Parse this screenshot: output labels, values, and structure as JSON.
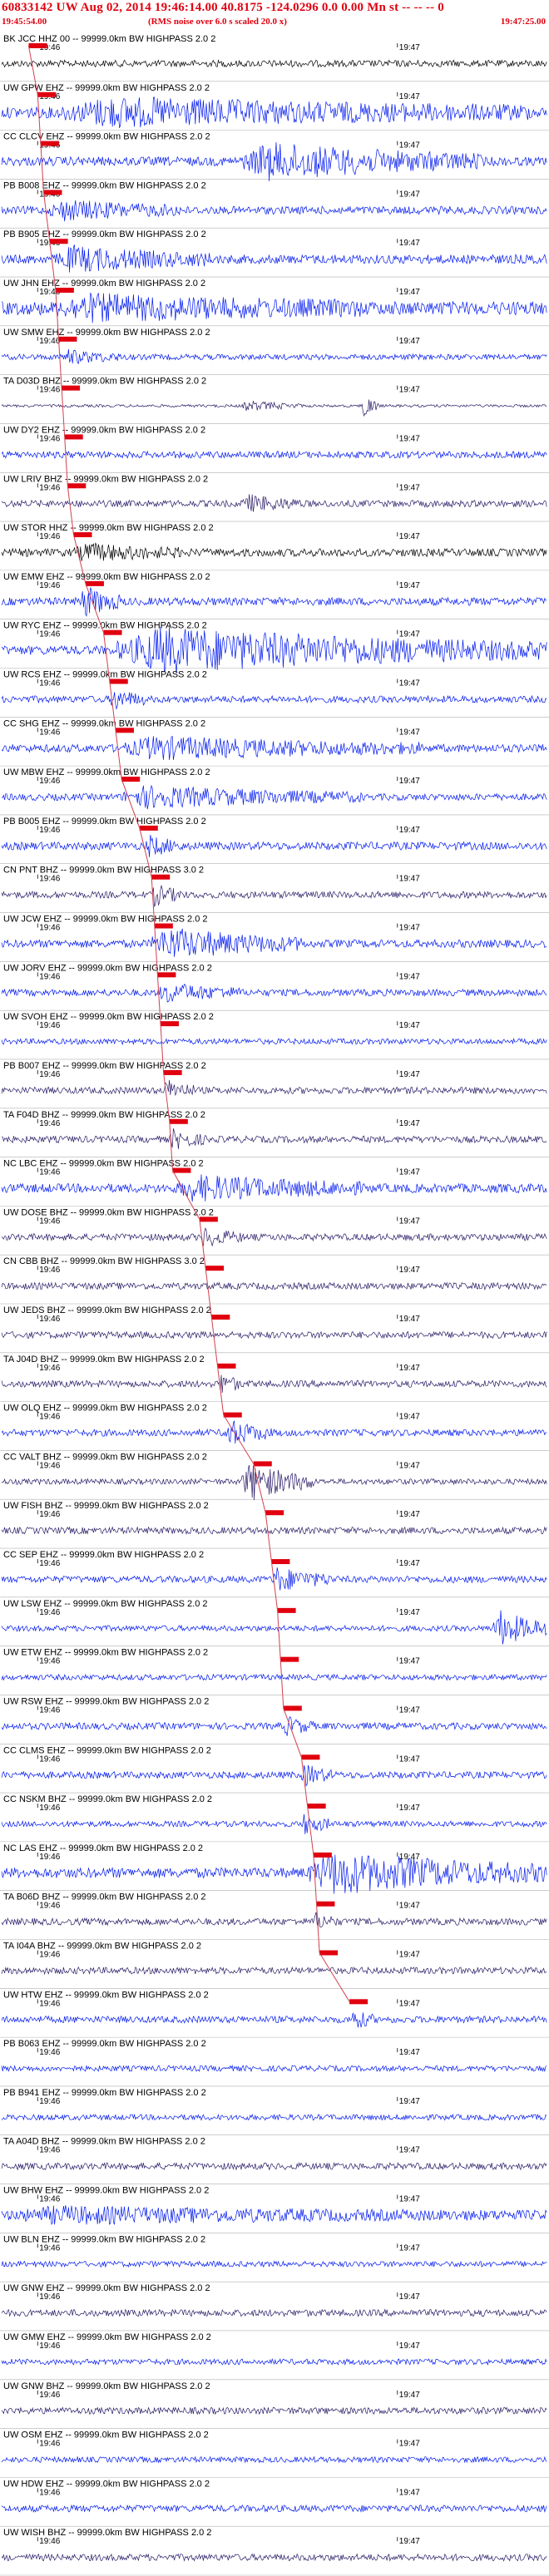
{
  "header": {
    "title": "60833142 UW Aug 02, 2014 19:46:14.00   40.8175 -124.0296  0.0 0.00 Mn st -- -- -- 0",
    "start_time": "19:45:54.00",
    "note": "(RMS noise over 6.0 s scaled 20.0 x)",
    "end_time": "19:47:25.00"
  },
  "colors": {
    "header_text": "#e0000f",
    "pick_box": "#e0000f",
    "pick_line": "#d04050",
    "trace_palette": [
      "#0018f0",
      "#2a1a66",
      "#000000"
    ]
  },
  "chart_data": {
    "type": "line",
    "title": "60833142 UW Aug 02, 2014 19:46:14.00   40.8175 -124.0296  0.0 0.00 Mn st -- -- -- 0",
    "x_range_time": [
      "19:45:54.00",
      "19:47:25.00"
    ],
    "x_tick_labels": [
      "19:46",
      "19:47"
    ],
    "tick_times_s": [
      6,
      66
    ],
    "pick_line": true,
    "traces": [
      {
        "label": "BK JCC HHZ 00 -- 99999.0km BW HIGHPASS 2.0 2",
        "pick_s": 4.5,
        "color": 2,
        "amp": 0.3,
        "bursts": []
      },
      {
        "label": "UW GPW EHZ -- 99999.0km BW HIGHPASS 2.0 2",
        "pick_s": 6,
        "color": 0,
        "amp": 0.5,
        "bursts": [
          [
            10,
            88,
            1.0
          ]
        ]
      },
      {
        "label": "CC CLCV EHZ -- 99999.0km BW HIGHPASS 2.0 2",
        "pick_s": 6.5,
        "color": 0,
        "amp": 0.4,
        "bursts": [
          [
            40,
            80,
            1.4
          ]
        ]
      },
      {
        "label": "PB B008 EHZ -- 99999.0km BW HIGHPASS 2.0 2",
        "pick_s": 7,
        "color": 0,
        "amp": 0.35,
        "bursts": [
          [
            8,
            30,
            0.7
          ]
        ]
      },
      {
        "label": "PB B905 EHZ -- 99999.0km BW HIGHPASS 2.0 2",
        "pick_s": 8,
        "color": 0,
        "amp": 0.4,
        "bursts": [
          [
            9,
            35,
            0.9
          ]
        ]
      },
      {
        "label": "UW JHN EHZ -- 99999.0km BW HIGHPASS 2.0 2",
        "pick_s": 9,
        "color": 0,
        "amp": 0.6,
        "bursts": [
          [
            9,
            60,
            0.8
          ]
        ]
      },
      {
        "label": "UW SMW EHZ -- 99999.0km BW HIGHPASS 2.0 2",
        "pick_s": 9.5,
        "color": 0,
        "amp": 0.25,
        "bursts": [
          [
            10,
            20,
            0.5
          ]
        ]
      },
      {
        "label": "TA D03D BHZ -- 99999.0km BW HIGHPASS 2.0 2",
        "pick_s": 10,
        "color": 1,
        "amp": 0.12,
        "bursts": [
          [
            40,
            50,
            0.4
          ],
          [
            60,
            63,
            1.1
          ]
        ]
      },
      {
        "label": "UW DY2 EHZ -- 99999.0km BW HIGHPASS 2.0 2",
        "pick_s": 10.5,
        "color": 0,
        "amp": 0.3,
        "bursts": []
      },
      {
        "label": "UW LRIV BHZ -- 99999.0km BW HIGHPASS 2.0 2",
        "pick_s": 11,
        "color": 1,
        "amp": 0.3,
        "bursts": [
          [
            40,
            50,
            0.6
          ]
        ]
      },
      {
        "label": "UW STOR HHZ -- 99999.0km BW HIGHPASS 2.0 2",
        "pick_s": 12,
        "color": 2,
        "amp": 0.35,
        "bursts": [
          [
            12,
            30,
            0.6
          ]
        ]
      },
      {
        "label": "UW EMW EHZ -- 99999.0km BW HIGHPASS 2.0 2",
        "pick_s": 14,
        "color": 0,
        "amp": 0.35,
        "bursts": [
          [
            13,
            20,
            1.2
          ]
        ]
      },
      {
        "label": "UW RYC EHZ -- 99999.0km BW HIGHPASS 2.0 2",
        "pick_s": 17,
        "color": 0,
        "amp": 0.4,
        "bursts": [
          [
            19,
            91,
            1.8
          ]
        ]
      },
      {
        "label": "UW RCS EHZ -- 99999.0km BW HIGHPASS 2.0 2",
        "pick_s": 18,
        "color": 0,
        "amp": 0.3,
        "bursts": [
          [
            18,
            24,
            0.8
          ]
        ]
      },
      {
        "label": "CC SHG EHZ -- 99999.0km BW HIGHPASS 2.0 2",
        "pick_s": 19,
        "color": 0,
        "amp": 0.35,
        "bursts": [
          [
            20,
            70,
            0.8
          ]
        ]
      },
      {
        "label": "UW MBW EHZ -- 99999.0km BW HIGHPASS 2.0 2",
        "pick_s": 20,
        "color": 0,
        "amp": 0.3,
        "bursts": [
          [
            20,
            60,
            0.8
          ]
        ]
      },
      {
        "label": "PB B005 EHZ -- 99999.0km BW HIGHPASS 2.0 2",
        "pick_s": 23,
        "color": 0,
        "amp": 0.35,
        "bursts": [
          [
            24,
            30,
            0.7
          ]
        ]
      },
      {
        "label": "CN PNT BHZ -- 99999.0km BW HIGHPASS 3.0 2",
        "pick_s": 25,
        "color": 1,
        "amp": 0.3,
        "bursts": [
          [
            25,
            30,
            0.8
          ]
        ]
      },
      {
        "label": "UW JCW EHZ -- 99999.0km BW HIGHPASS 2.0 2",
        "pick_s": 25.5,
        "color": 0,
        "amp": 0.35,
        "bursts": [
          [
            25,
            50,
            1.2
          ]
        ]
      },
      {
        "label": "UW JORV EHZ -- 99999.0km BW HIGHPASS 2.0 2",
        "pick_s": 26,
        "color": 0,
        "amp": 0.3,
        "bursts": [
          [
            26,
            40,
            0.7
          ]
        ]
      },
      {
        "label": "UW SVOH EHZ -- 99999.0km BW HIGHPASS 2.0 2",
        "pick_s": 26.5,
        "color": 0,
        "amp": 0.25,
        "bursts": []
      },
      {
        "label": "PB B007 EHZ -- 99999.0km BW HIGHPASS 2.0 2",
        "pick_s": 27,
        "color": 1,
        "amp": 0.3,
        "bursts": [
          [
            27,
            32,
            0.8
          ]
        ]
      },
      {
        "label": "TA F04D BHZ -- 99999.0km BW HIGHPASS 2.0 2",
        "pick_s": 28,
        "color": 1,
        "amp": 0.3,
        "bursts": [
          [
            28,
            34,
            0.7
          ]
        ]
      },
      {
        "label": "NC LBC EHZ -- 99999.0km BW HIGHPASS 2.0 2",
        "pick_s": 28.5,
        "color": 0,
        "amp": 0.4,
        "bursts": [
          [
            29,
            60,
            0.9
          ]
        ]
      },
      {
        "label": "UW DOSE BHZ -- 99999.0km BW HIGHPASS 2.0 2",
        "pick_s": 33,
        "color": 1,
        "amp": 0.3,
        "bursts": [
          [
            33,
            40,
            0.7
          ]
        ]
      },
      {
        "label": "CN CBB BHZ -- 99999.0km BW HIGHPASS 3.0 2",
        "pick_s": 34,
        "color": 1,
        "amp": 0.3,
        "bursts": []
      },
      {
        "label": "UW JEDS BHZ -- 99999.0km BW HIGHPASS 2.0 2",
        "pick_s": 35,
        "color": 1,
        "amp": 0.3,
        "bursts": []
      },
      {
        "label": "TA J04D BHZ -- 99999.0km BW HIGHPASS 2.0 2",
        "pick_s": 36,
        "color": 1,
        "amp": 0.3,
        "bursts": [
          [
            36,
            40,
            0.8
          ]
        ]
      },
      {
        "label": "UW OLQ EHZ -- 99999.0km BW HIGHPASS 2.0 2",
        "pick_s": 37,
        "color": 0,
        "amp": 0.3,
        "bursts": [
          [
            37,
            45,
            1.0
          ]
        ]
      },
      {
        "label": "CC VALT BHZ -- 99999.0km BW HIGHPASS 2.0 2",
        "pick_s": 42,
        "color": 1,
        "amp": 0.25,
        "bursts": [
          [
            40,
            52,
            1.6
          ]
        ]
      },
      {
        "label": "UW FISH BHZ -- 99999.0km BW HIGHPASS 2.0 2",
        "pick_s": 44,
        "color": 1,
        "amp": 0.3,
        "bursts": []
      },
      {
        "label": "CC SEP EHZ -- 99999.0km BW HIGHPASS 2.0 2",
        "pick_s": 45,
        "color": 0,
        "amp": 0.3,
        "bursts": [
          [
            45,
            55,
            0.9
          ]
        ]
      },
      {
        "label": "UW LSW EHZ -- 99999.0km BW HIGHPASS 2.0 2",
        "pick_s": 46,
        "color": 0,
        "amp": 0.25,
        "bursts": [
          [
            82,
            91,
            1.5
          ]
        ]
      },
      {
        "label": "UW ETW EHZ -- 99999.0km BW HIGHPASS 2.0 2",
        "pick_s": 46.5,
        "color": 0,
        "amp": 0.25,
        "bursts": []
      },
      {
        "label": "UW RSW EHZ -- 99999.0km BW HIGHPASS 2.0 2",
        "pick_s": 47,
        "color": 0,
        "amp": 0.3,
        "bursts": [
          [
            47,
            52,
            0.7
          ]
        ]
      },
      {
        "label": "CC CLMS EHZ -- 99999.0km BW HIGHPASS 2.0 2",
        "pick_s": 50,
        "color": 0,
        "amp": 0.3,
        "bursts": [
          [
            50,
            55,
            0.8
          ]
        ]
      },
      {
        "label": "CC NSKM BHZ -- 99999.0km BW HIGHPASS 2.0 2",
        "pick_s": 51,
        "color": 0,
        "amp": 0.25,
        "bursts": [
          [
            50,
            55,
            0.8
          ]
        ]
      },
      {
        "label": "NC LAS EHZ -- 99999.0km BW HIGHPASS 2.0 2",
        "pick_s": 52,
        "color": 0,
        "amp": 0.45,
        "bursts": [
          [
            51,
            91,
            1.6
          ]
        ]
      },
      {
        "label": "TA B06D BHZ -- 99999.0km BW HIGHPASS 2.0 2",
        "pick_s": 52.5,
        "color": 1,
        "amp": 0.3,
        "bursts": [
          [
            52,
            56,
            0.6
          ]
        ]
      },
      {
        "label": "TA I04A BHZ -- 99999.0km BW HIGHPASS 2.0 2",
        "pick_s": 53,
        "color": 1,
        "amp": 0.3,
        "bursts": []
      },
      {
        "label": "UW HTW EHZ -- 99999.0km BW HIGHPASS 2.0 2",
        "pick_s": 58,
        "color": 0,
        "amp": 0.3,
        "bursts": [
          [
            58,
            62,
            0.8
          ]
        ]
      },
      {
        "label": "PB B063 EHZ -- 99999.0km BW HIGHPASS 2.0 2",
        "pick_s": null,
        "color": 0,
        "amp": 0.25,
        "bursts": []
      },
      {
        "label": "PB B941 EHZ -- 99999.0km BW HIGHPASS 2.0 2",
        "pick_s": null,
        "color": 0,
        "amp": 0.25,
        "bursts": []
      },
      {
        "label": "TA A04D BHZ -- 99999.0km BW HIGHPASS 2.0 2",
        "pick_s": null,
        "color": 1,
        "amp": 0.3,
        "bursts": []
      },
      {
        "label": "UW BHW EHZ -- 99999.0km BW HIGHPASS 2.0 2",
        "pick_s": null,
        "color": 0,
        "amp": 0.3,
        "bursts": [
          [
            0,
            91,
            0.6
          ]
        ]
      },
      {
        "label": "UW BLN EHZ -- 99999.0km BW HIGHPASS 2.0 2",
        "pick_s": null,
        "color": 0,
        "amp": 0.25,
        "bursts": []
      },
      {
        "label": "UW GNW EHZ -- 99999.0km BW HIGHPASS 2.0 2",
        "pick_s": null,
        "color": 1,
        "amp": 0.3,
        "bursts": []
      },
      {
        "label": "UW GMW EHZ -- 99999.0km BW HIGHPASS 2.0 2",
        "pick_s": null,
        "color": 0,
        "amp": 0.25,
        "bursts": []
      },
      {
        "label": "UW GNW BHZ -- 99999.0km BW HIGHPASS 2.0 2",
        "pick_s": null,
        "color": 1,
        "amp": 0.3,
        "bursts": []
      },
      {
        "label": "UW OSM EHZ -- 99999.0km BW HIGHPASS 2.0 2",
        "pick_s": null,
        "color": 0,
        "amp": 0.25,
        "bursts": []
      },
      {
        "label": "UW HDW EHZ -- 99999.0km BW HIGHPASS 2.0 2",
        "pick_s": null,
        "color": 0,
        "amp": 0.3,
        "bursts": []
      },
      {
        "label": "UW WISH BHZ -- 99999.0km BW HIGHPASS 2.0 2",
        "pick_s": null,
        "color": 1,
        "amp": 0.3,
        "bursts": []
      }
    ]
  }
}
